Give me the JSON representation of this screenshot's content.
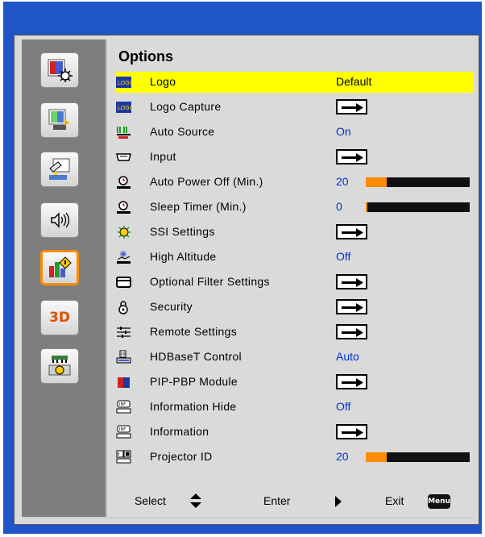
{
  "menu": {
    "title": "Options",
    "items": [
      {
        "label": "Logo",
        "value": "Default",
        "icon": "logo-icon"
      },
      {
        "label": "Logo Capture",
        "arrow": true,
        "icon": "logo-capture-icon"
      },
      {
        "label": "Auto Source",
        "value": "On",
        "icon": "auto-source-icon"
      },
      {
        "label": "Input",
        "arrow": true,
        "icon": "input-icon"
      },
      {
        "label": "Auto Power Off (Min.)",
        "value": "20",
        "level": 0.2,
        "icon": "auto-power-off-icon"
      },
      {
        "label": "Sleep Timer (Min.)",
        "value": "0",
        "level": 0.0,
        "icon": "sleep-timer-icon"
      },
      {
        "label": "SSI Settings",
        "arrow": true,
        "icon": "ssi-settings-icon"
      },
      {
        "label": "High Altitude",
        "value": "Off",
        "icon": "high-altitude-icon"
      },
      {
        "label": "Optional Filter Settings",
        "arrow": true,
        "icon": "filter-icon"
      },
      {
        "label": "Security",
        "arrow": true,
        "icon": "security-lock-icon"
      },
      {
        "label": "Remote Settings",
        "arrow": true,
        "icon": "remote-settings-icon"
      },
      {
        "label": "HDBaseT Control",
        "value": "Auto",
        "icon": "hdbaset-icon"
      },
      {
        "label": "PIP-PBP Module",
        "arrow": true,
        "icon": "pip-pbp-icon"
      },
      {
        "label": "Information Hide",
        "value": "Off",
        "icon": "information-hide-icon"
      },
      {
        "label": "Information",
        "arrow": true,
        "icon": "information-icon"
      },
      {
        "label": "Projector ID",
        "value": "20",
        "level": 0.2,
        "icon": "projector-id-icon"
      }
    ]
  },
  "footer": {
    "select": "Select",
    "enter": "Enter",
    "exit": "Exit",
    "menu_key": "Menu"
  },
  "sidebar": [
    "image-settings-icon",
    "display-settings-icon",
    "setup-icon",
    "volume-icon",
    "options-icon",
    "3d-icon",
    "lan-icon"
  ],
  "sidebar_3d_label": "3D",
  "colors": {
    "frame": "#1f55c7",
    "highlight": "#ffff00",
    "accent": "#ff8c00",
    "value_text": "#0033cc"
  }
}
